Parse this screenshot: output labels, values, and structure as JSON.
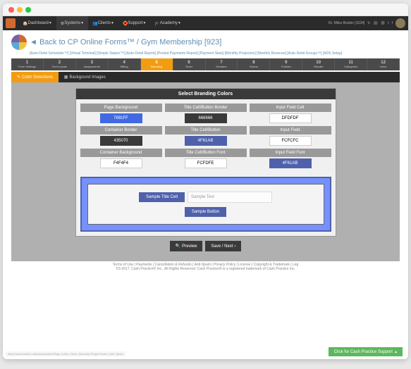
{
  "nav": {
    "items": [
      "Dashboard",
      "Systems",
      "Clients",
      "Support",
      "Academy"
    ],
    "active_index": 1,
    "user_label": "Dr. Miles Bodzin [1034]"
  },
  "page": {
    "title": "◄ Back to CP Online Forms™ / Gym Membership [923]",
    "sublinks": "[Auto-Debit Scheduler™] [Virtual Terminal] [Simple Swiper™] [Auto-Debit Report] [Posted Payments Report] [Payment Stats] [Monthly Projection] [Monthly Revenue] [Auto-Debit Groups™] [ADS Setup]"
  },
  "steps": [
    {
      "num": "1",
      "label": "Form Settings"
    },
    {
      "num": "2",
      "label": "Form Inputs"
    },
    {
      "num": "3",
      "label": "Assignments"
    },
    {
      "num": "4",
      "label": "Billing"
    },
    {
      "num": "5",
      "label": "Branding"
    },
    {
      "num": "6",
      "label": "Timer"
    },
    {
      "num": "7",
      "label": "Headers"
    },
    {
      "num": "8",
      "label": "Videos"
    },
    {
      "num": "9",
      "label": "Policies"
    },
    {
      "num": "10",
      "label": "Results"
    },
    {
      "num": "11",
      "label": "Categories"
    },
    {
      "num": "12",
      "label": "Links"
    }
  ],
  "active_step": 4,
  "tabs": {
    "color": "Color Selections",
    "images": "Backgound Images"
  },
  "active_tab": 0,
  "card": {
    "header": "Select Branding Colors",
    "rows": [
      [
        {
          "label": "Page Background",
          "value": "7691FF",
          "style": "blue"
        },
        {
          "label": "Title Cell/Button Border",
          "value": "666666",
          "style": "dark"
        },
        {
          "label": "Input Field Cell",
          "value": "DFDFDF",
          "style": ""
        }
      ],
      [
        {
          "label": "Container Border",
          "value": "435070",
          "style": "dark"
        },
        {
          "label": "Title Cell/Button",
          "value": "4F61AB",
          "style": "navy"
        },
        {
          "label": "Input Field",
          "value": "FCFCFC",
          "style": ""
        }
      ],
      [
        {
          "label": "Container Background",
          "value": "F4F4F4",
          "style": ""
        },
        {
          "label": "Title Cell/Button Font",
          "value": "FCFDFE",
          "style": ""
        },
        {
          "label": "Input Field Font",
          "value": "4F61AB",
          "style": "navy"
        }
      ]
    ]
  },
  "preview": {
    "title_cell": "Sample Title Cell",
    "input_placeholder": "Sample Text",
    "button": "Sample Button"
  },
  "actions": {
    "preview": "Preview",
    "save": "Save / Next"
  },
  "footer": {
    "links": "Terms of Use  |  Payments  |  Cancellation & Refunds  |  Anti-Spam  |  Privacy Policy  |  License  |  Copyright & Trademark  |  Leg",
    "copyright": "©3-2017, Cash Practice® Inc., All Rights Reserved. Cash Practice® is a registered trademark of Cash Practice Inc."
  },
  "support_button": "Click for Cash Practice Support",
  "status_url": "https://www.bodzin.net/cashpractice/Page_Index_Clean_New.php?Page=Footer_Anti_Spam"
}
